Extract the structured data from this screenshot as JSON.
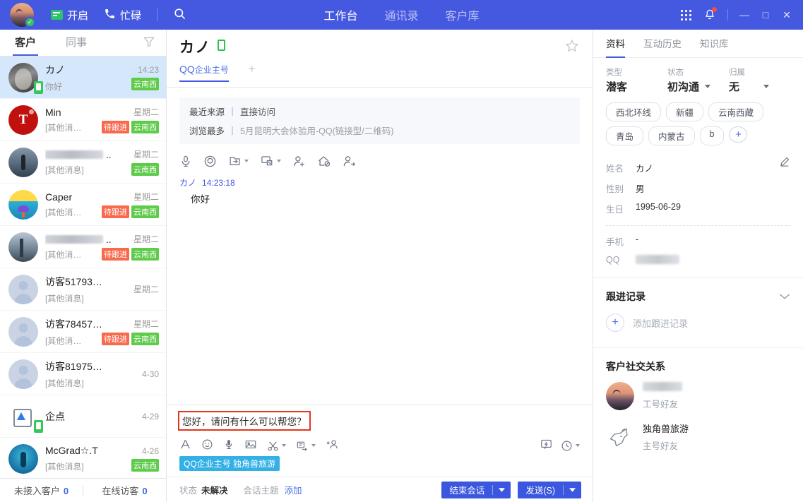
{
  "topbar": {
    "status_open_label": "开启",
    "status_busy_label": "忙碌",
    "search_icon": "search-icon",
    "nav": [
      {
        "label": "工作台",
        "active": true
      },
      {
        "label": "通讯录",
        "active": false
      },
      {
        "label": "客户库",
        "active": false
      }
    ],
    "apps_icon": "grid-apps-icon",
    "bell_icon": "bell-icon",
    "minimize": "—",
    "maximize": "□",
    "close": "✕"
  },
  "left": {
    "tabs": [
      {
        "label": "客户",
        "active": true
      },
      {
        "label": "同事",
        "active": false
      }
    ],
    "filter_icon": "filter-icon",
    "conversations": [
      {
        "name": "カノ",
        "preview": "你好",
        "time": "14:23",
        "tags": [
          "云南西"
        ],
        "selected": true,
        "avatar": "a1",
        "mobile": true
      },
      {
        "name": "Min",
        "preview": "[其他消…",
        "time": "星期二",
        "tags": [
          "待跟进",
          "云南西"
        ],
        "selected": false,
        "avatar": "a2",
        "mobile": false
      },
      {
        "name": "",
        "name_blurred": true,
        "preview": "[其他消息]",
        "time": "星期二",
        "tags": [
          "云南西"
        ],
        "selected": false,
        "avatar": "a3",
        "mobile": false
      },
      {
        "name": "Caper",
        "preview": "[其他消…",
        "time": "星期二",
        "tags": [
          "待跟进",
          "云南西"
        ],
        "selected": false,
        "avatar": "a4",
        "mobile": false
      },
      {
        "name": "",
        "name_blurred": true,
        "preview": "[其他消…",
        "time": "星期二",
        "tags": [
          "待跟进",
          "云南西"
        ],
        "selected": false,
        "avatar": "a5",
        "mobile": false
      },
      {
        "name": "访客51793…",
        "preview": "[其他消息]",
        "time": "星期二",
        "tags": [],
        "selected": false,
        "avatar": "default",
        "mobile": false
      },
      {
        "name": "访客78457…",
        "preview": "[其他消…",
        "time": "星期二",
        "tags": [
          "待跟进",
          "云南西"
        ],
        "selected": false,
        "avatar": "default",
        "mobile": false
      },
      {
        "name": "访客81975…",
        "preview": "[其他消息]",
        "time": "4-30",
        "tags": [],
        "selected": false,
        "avatar": "default",
        "mobile": false
      },
      {
        "name": "企点",
        "preview": "",
        "time": "4-29",
        "tags": [],
        "selected": false,
        "avatar": "qidian",
        "mobile": true
      },
      {
        "name": "McGrad☆.T",
        "preview": "[其他消息]",
        "time": "4-26",
        "tags": [
          "云南西"
        ],
        "selected": false,
        "avatar": "a6",
        "mobile": false
      }
    ],
    "footer": {
      "unassigned_label": "未接入客户",
      "unassigned_count": "0",
      "online_label": "在线访客",
      "online_count": "0"
    }
  },
  "center": {
    "contact_name": "カノ",
    "mobile_icon": "mobile-icon",
    "star_icon": "star-icon",
    "tabs": [
      {
        "label_prefix": "QQ",
        "label_suffix": "企业主号",
        "active": true
      }
    ],
    "add_tab_icon": "plus-icon",
    "source": {
      "recent_key": "最近来源",
      "recent_value": "直接访问",
      "most_key": "浏览最多",
      "most_value": "5月昆明大会体验用-QQ(链接型/二维码)"
    },
    "tools": [
      {
        "name": "microphone-icon"
      },
      {
        "name": "camera-icon"
      },
      {
        "name": "transfer-session-icon",
        "caret": true
      },
      {
        "name": "remote-desktop-icon",
        "caret": true
      },
      {
        "name": "add-member-icon"
      },
      {
        "name": "block-home-icon"
      },
      {
        "name": "invite-member-icon"
      }
    ],
    "messages": [
      {
        "sender": "カノ",
        "time": "14:23:18",
        "text": "你好"
      }
    ],
    "input": {
      "value": "您好，请问有什么可以帮您？",
      "tools": [
        {
          "name": "font-icon"
        },
        {
          "name": "emoji-icon"
        },
        {
          "name": "voice-icon"
        },
        {
          "name": "image-icon"
        },
        {
          "name": "screenshot-icon",
          "caret": true
        },
        {
          "name": "quick-reply-icon",
          "caret": true
        },
        {
          "name": "add-contact-icon"
        }
      ],
      "right_tools": [
        {
          "name": "feedback-icon"
        },
        {
          "name": "history-icon",
          "caret": true
        }
      ],
      "keyword_chip": "QQ企业主号 独角兽旅游"
    },
    "footer": {
      "status_key": "状态",
      "status_value": "未解决",
      "topic_key": "会话主题",
      "topic_link": "添加",
      "end_button": "结束会话",
      "send_button": "发送(S)"
    }
  },
  "right": {
    "tabs": [
      {
        "label": "资料",
        "active": true
      },
      {
        "label": "互动历史",
        "active": false
      },
      {
        "label": "知识库",
        "active": false
      }
    ],
    "selects": [
      {
        "key": "类型",
        "value": "潜客",
        "caret": false
      },
      {
        "key": "状态",
        "value": "初沟通",
        "caret": true
      },
      {
        "key": "归属",
        "value": "无",
        "caret": true
      }
    ],
    "chips": [
      "西北环线",
      "新疆",
      "云南西藏",
      "青岛",
      "内蒙古",
      "b"
    ],
    "chip_add": "+",
    "profile": [
      {
        "key": "姓名",
        "value": "カノ"
      },
      {
        "key": "性别",
        "value": "男"
      },
      {
        "key": "生日",
        "value": "1995-06-29"
      }
    ],
    "contact": [
      {
        "key": "手机",
        "value": "-"
      },
      {
        "key": "QQ",
        "value": "",
        "blurred": true
      }
    ],
    "edit_icon": "pencil-icon",
    "followup": {
      "title": "跟进记录",
      "collapse_icon": "chevron-down-icon",
      "add_label": "添加跟进记录",
      "add_icon": "plus-icon"
    },
    "social": {
      "title": "客户社交关系",
      "items": [
        {
          "name": "",
          "name_blurred": true,
          "sub": "工号好友",
          "avatar": "sunset"
        },
        {
          "name": "独角兽旅游",
          "sub": "主号好友",
          "avatar": "unicorn"
        }
      ]
    }
  },
  "colors": {
    "brand": "#4458e0",
    "accent_blue": "#3b57df",
    "tag_follow": "#f76a4e",
    "tag_region": "#5ecb4a",
    "chip_keyword": "#33b0e6",
    "highlight_red": "#e2351e",
    "selected_row": "#d5e7fb"
  }
}
